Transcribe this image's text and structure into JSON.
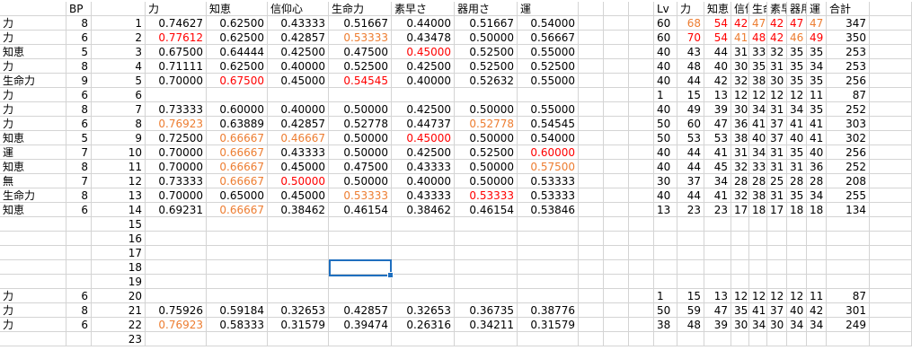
{
  "sheet": {
    "selected_cell": "E18",
    "header": {
      "A": "",
      "B": "BP",
      "C": "",
      "D": "力",
      "E": "知恵",
      "F": "信仰心",
      "G": "生命力",
      "H": "素早さ",
      "I": "器用さ",
      "J": "運",
      "K": "",
      "L": "",
      "M": "",
      "N": "Lv",
      "O": "力",
      "P": "知恵",
      "Q": "信仰",
      "R": "生命",
      "S": "素早",
      "T": "器用",
      "U": "運",
      "V": "合計"
    },
    "colors": {
      "red": "#ff0000",
      "orange": "#ed7d31",
      "default": "#000000",
      "selection": "#1f6fbf"
    },
    "rows": [
      {
        "A": "力",
        "B": "8",
        "C": "1",
        "D": "0.74627",
        "E": "0.62500",
        "F": "0.43333",
        "G": "0.51667",
        "H": "0.44000",
        "I": "0.51667",
        "J": "0.54000",
        "N": "60",
        "O": "68",
        "P": "54",
        "Q": "42",
        "R": "47",
        "S": "42",
        "T": "47",
        "U": "47",
        "V": "347",
        "style": {
          "O": "ora",
          "P": "red",
          "Q": "red",
          "R": "ora",
          "S": "red",
          "T": "red",
          "U": "ora"
        }
      },
      {
        "A": "力",
        "B": "6",
        "C": "2",
        "D": "0.77612",
        "E": "0.62500",
        "F": "0.42857",
        "G": "0.53333",
        "H": "0.43478",
        "I": "0.50000",
        "J": "0.56667",
        "N": "60",
        "O": "70",
        "P": "54",
        "Q": "41",
        "R": "48",
        "S": "42",
        "T": "46",
        "U": "49",
        "V": "350",
        "style": {
          "D": "red",
          "G": "ora",
          "O": "red",
          "P": "red",
          "Q": "ora",
          "R": "red",
          "S": "red",
          "T": "ora",
          "U": "red"
        }
      },
      {
        "A": "知恵",
        "B": "5",
        "C": "3",
        "D": "0.67500",
        "E": "0.64444",
        "F": "0.42500",
        "G": "0.47500",
        "H": "0.45000",
        "I": "0.52500",
        "J": "0.55000",
        "N": "40",
        "O": "43",
        "P": "44",
        "Q": "31",
        "R": "33",
        "S": "32",
        "T": "35",
        "U": "35",
        "V": "253",
        "style": {
          "H": "red"
        }
      },
      {
        "A": "力",
        "B": "8",
        "C": "4",
        "D": "0.71111",
        "E": "0.62500",
        "F": "0.40000",
        "G": "0.52500",
        "H": "0.42500",
        "I": "0.52500",
        "J": "0.52500",
        "N": "40",
        "O": "48",
        "P": "40",
        "Q": "30",
        "R": "35",
        "S": "31",
        "T": "35",
        "U": "34",
        "V": "253",
        "style": {}
      },
      {
        "A": "生命力",
        "B": "9",
        "C": "5",
        "D": "0.70000",
        "E": "0.67500",
        "F": "0.45000",
        "G": "0.54545",
        "H": "0.40000",
        "I": "0.52632",
        "J": "0.55000",
        "N": "40",
        "O": "44",
        "P": "42",
        "Q": "32",
        "R": "38",
        "S": "30",
        "T": "35",
        "U": "35",
        "V": "256",
        "style": {
          "E": "red",
          "G": "red"
        }
      },
      {
        "A": "力",
        "B": "6",
        "C": "6",
        "D": "",
        "E": "",
        "F": "",
        "G": "",
        "H": "",
        "I": "",
        "J": "",
        "N": "1",
        "O": "15",
        "P": "13",
        "Q": "12",
        "R": "12",
        "S": "12",
        "T": "12",
        "U": "11",
        "V": "87",
        "style": {}
      },
      {
        "A": "力",
        "B": "8",
        "C": "7",
        "D": "0.73333",
        "E": "0.60000",
        "F": "0.40000",
        "G": "0.50000",
        "H": "0.42500",
        "I": "0.50000",
        "J": "0.55000",
        "N": "40",
        "O": "49",
        "P": "39",
        "Q": "30",
        "R": "34",
        "S": "31",
        "T": "34",
        "U": "35",
        "V": "252",
        "style": {}
      },
      {
        "A": "力",
        "B": "6",
        "C": "8",
        "D": "0.76923",
        "E": "0.63889",
        "F": "0.42857",
        "G": "0.52778",
        "H": "0.44737",
        "I": "0.52778",
        "J": "0.54545",
        "N": "50",
        "O": "60",
        "P": "47",
        "Q": "36",
        "R": "41",
        "S": "37",
        "T": "41",
        "U": "41",
        "V": "303",
        "style": {
          "D": "ora",
          "I": "ora"
        }
      },
      {
        "A": "知恵",
        "B": "5",
        "C": "9",
        "D": "0.72500",
        "E": "0.66667",
        "F": "0.46667",
        "G": "0.50000",
        "H": "0.45000",
        "I": "0.50000",
        "J": "0.54000",
        "N": "50",
        "O": "53",
        "P": "53",
        "Q": "38",
        "R": "40",
        "S": "37",
        "T": "40",
        "U": "41",
        "V": "302",
        "style": {
          "E": "ora",
          "F": "ora",
          "H": "red"
        }
      },
      {
        "A": "運",
        "B": "7",
        "C": "10",
        "D": "0.70000",
        "E": "0.66667",
        "F": "0.43333",
        "G": "0.50000",
        "H": "0.42500",
        "I": "0.52500",
        "J": "0.60000",
        "N": "40",
        "O": "44",
        "P": "41",
        "Q": "31",
        "R": "34",
        "S": "31",
        "T": "35",
        "U": "40",
        "V": "256",
        "style": {
          "E": "ora",
          "J": "red"
        }
      },
      {
        "A": "知恵",
        "B": "8",
        "C": "11",
        "D": "0.70000",
        "E": "0.66667",
        "F": "0.45000",
        "G": "0.47500",
        "H": "0.43333",
        "I": "0.50000",
        "J": "0.57500",
        "N": "40",
        "O": "44",
        "P": "45",
        "Q": "32",
        "R": "33",
        "S": "31",
        "T": "31",
        "U": "36",
        "V": "252",
        "style": {
          "E": "ora",
          "J": "ora"
        }
      },
      {
        "A": "無",
        "B": "7",
        "C": "12",
        "D": "0.73333",
        "E": "0.66667",
        "F": "0.50000",
        "G": "0.50000",
        "H": "0.40000",
        "I": "0.50000",
        "J": "0.53333",
        "N": "30",
        "O": "37",
        "P": "34",
        "Q": "28",
        "R": "28",
        "S": "25",
        "T": "28",
        "U": "28",
        "V": "208",
        "style": {
          "E": "ora",
          "F": "red"
        }
      },
      {
        "A": "生命力",
        "B": "8",
        "C": "13",
        "D": "0.70000",
        "E": "0.65000",
        "F": "0.45000",
        "G": "0.53333",
        "H": "0.43333",
        "I": "0.53333",
        "J": "0.53333",
        "N": "40",
        "O": "44",
        "P": "41",
        "Q": "32",
        "R": "38",
        "S": "31",
        "T": "35",
        "U": "34",
        "V": "255",
        "style": {
          "G": "ora",
          "I": "red"
        }
      },
      {
        "A": "知恵",
        "B": "6",
        "C": "14",
        "D": "0.69231",
        "E": "0.66667",
        "F": "0.38462",
        "G": "0.46154",
        "H": "0.38462",
        "I": "0.46154",
        "J": "0.53846",
        "N": "13",
        "O": "23",
        "P": "23",
        "Q": "17",
        "R": "18",
        "S": "17",
        "T": "18",
        "U": "18",
        "V": "134",
        "style": {
          "E": "ora"
        }
      },
      {
        "C": "15",
        "style": {}
      },
      {
        "C": "16",
        "style": {}
      },
      {
        "C": "17",
        "style": {}
      },
      {
        "C": "18",
        "style": {}
      },
      {
        "C": "19",
        "style": {}
      },
      {
        "A": "力",
        "B": "6",
        "C": "20",
        "N": "1",
        "O": "15",
        "P": "13",
        "Q": "12",
        "R": "12",
        "S": "12",
        "T": "12",
        "U": "11",
        "V": "87",
        "style": {}
      },
      {
        "A": "力",
        "B": "8",
        "C": "21",
        "D": "0.75926",
        "E": "0.59184",
        "F": "0.32653",
        "G": "0.42857",
        "H": "0.32653",
        "I": "0.36735",
        "J": "0.38776",
        "N": "50",
        "O": "59",
        "P": "47",
        "Q": "35",
        "R": "41",
        "S": "37",
        "T": "40",
        "U": "42",
        "V": "301",
        "style": {}
      },
      {
        "A": "力",
        "B": "6",
        "C": "22",
        "D": "0.76923",
        "E": "0.58333",
        "F": "0.31579",
        "G": "0.39474",
        "H": "0.26316",
        "I": "0.34211",
        "J": "0.31579",
        "N": "38",
        "O": "48",
        "P": "39",
        "Q": "30",
        "R": "34",
        "S": "30",
        "T": "34",
        "U": "34",
        "V": "249",
        "style": {
          "D": "ora"
        }
      },
      {
        "C": "23",
        "style": {}
      }
    ]
  }
}
